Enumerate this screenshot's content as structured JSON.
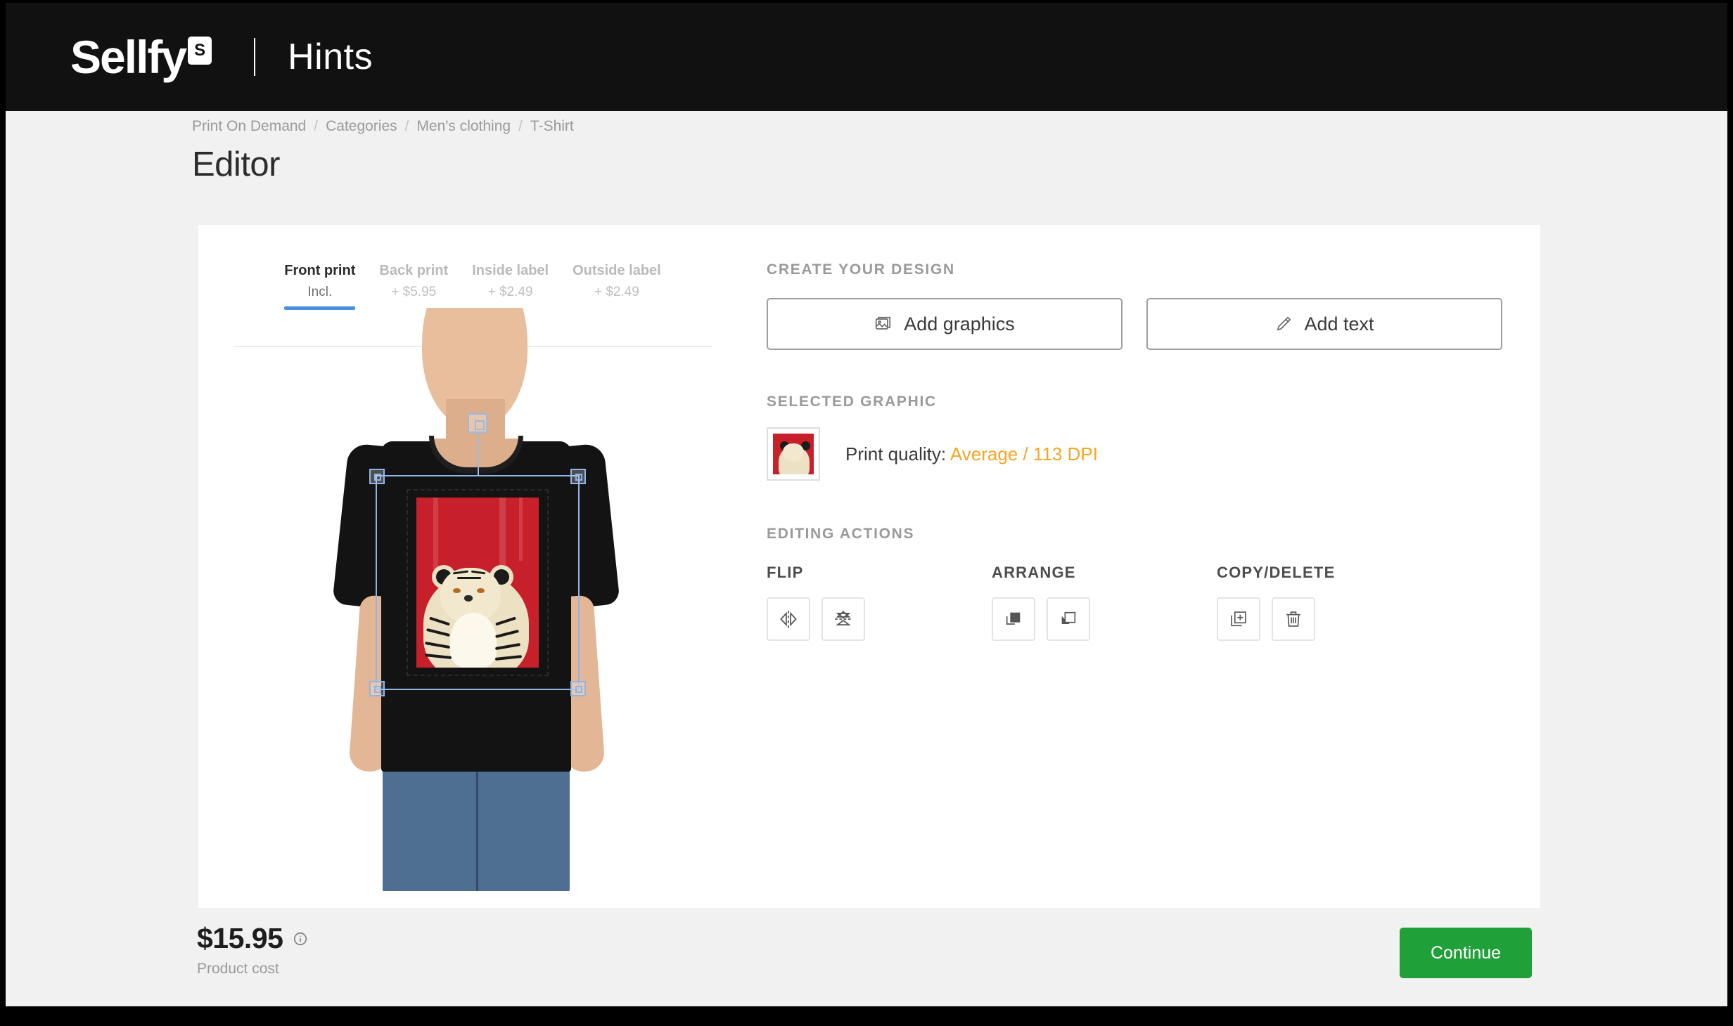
{
  "topbar": {
    "logo_text": "Sellfy",
    "logo_badge": "S",
    "title": "Hints"
  },
  "breadcrumb": {
    "items": [
      "Print On Demand",
      "Categories",
      "Men's clothing",
      "T-Shirt"
    ],
    "separator": "/"
  },
  "page": {
    "title": "Editor"
  },
  "preview": {
    "tabs": [
      {
        "label": "Front print",
        "price": "Incl.",
        "active": true
      },
      {
        "label": "Back print",
        "price": "+ $5.95",
        "active": false
      },
      {
        "label": "Inside label",
        "price": "+ $2.49",
        "active": false
      },
      {
        "label": "Outside label",
        "price": "+ $2.49",
        "active": false
      }
    ]
  },
  "panel": {
    "create_title": "Create your design",
    "add_graphics_label": "Add graphics",
    "add_text_label": "Add text",
    "selected_graphic_title": "Selected graphic",
    "quality_label": "Print quality:",
    "quality_value": "Average / 113 DPI",
    "quality_color": "#F5A623",
    "editing_title": "Editing actions",
    "groups": [
      {
        "label": "Flip",
        "buttons": [
          {
            "name": "flip-horizontal"
          },
          {
            "name": "flip-vertical"
          }
        ]
      },
      {
        "label": "Arrange",
        "buttons": [
          {
            "name": "bring-to-front"
          },
          {
            "name": "send-to-back"
          }
        ]
      },
      {
        "label": "Copy/Delete",
        "buttons": [
          {
            "name": "duplicate"
          },
          {
            "name": "delete"
          }
        ]
      }
    ]
  },
  "footer": {
    "price": "$15.95",
    "price_caption": "Product cost",
    "continue_label": "Continue",
    "continue_color": "#20A038"
  }
}
